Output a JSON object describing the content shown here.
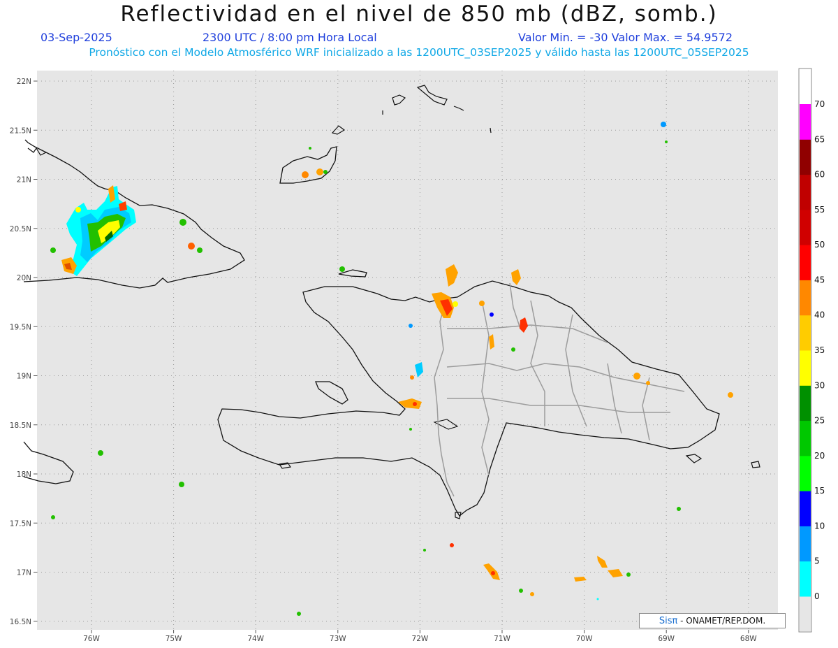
{
  "header": {
    "title": "Reflectividad en el nivel de 850 mb (dBZ, somb.)",
    "date": "03-Sep-2025",
    "time": "2300 UTC / 8:00 pm Hora Local",
    "minmax": "Valor Min. = -30  Valor Max. = 54.9572",
    "forecast": "Pronóstico con el Modelo Atmosférico WRF inicializado a las 1200UTC_03SEP2025 y válido hasta las  1200UTC_05SEP2025"
  },
  "axes": {
    "lat_labels": [
      "22N",
      "21.5N",
      "21N",
      "20.5N",
      "20N",
      "19.5N",
      "19N",
      "18.5N",
      "18N",
      "17.5N",
      "17N",
      "16.5N"
    ],
    "lon_labels": [
      "76W",
      "75W",
      "74W",
      "73W",
      "72W",
      "71W",
      "70W",
      "69W",
      "68W"
    ]
  },
  "colorbar": {
    "labels": [
      "0",
      "5",
      "10",
      "15",
      "20",
      "25",
      "30",
      "35",
      "40",
      "45",
      "50",
      "55",
      "60",
      "65",
      "70"
    ],
    "colors": [
      "#00ffff",
      "#0099ff",
      "#0000ff",
      "#00ff00",
      "#00c800",
      "#009000",
      "#ffff00",
      "#ffcc00",
      "#ff8800",
      "#ff0000",
      "#d00000",
      "#c00000",
      "#900000",
      "#ff00ff",
      "#9900ff"
    ]
  },
  "credit": {
    "brand": "Sisπ",
    "org": "- ONAMET/REP.DOM."
  }
}
